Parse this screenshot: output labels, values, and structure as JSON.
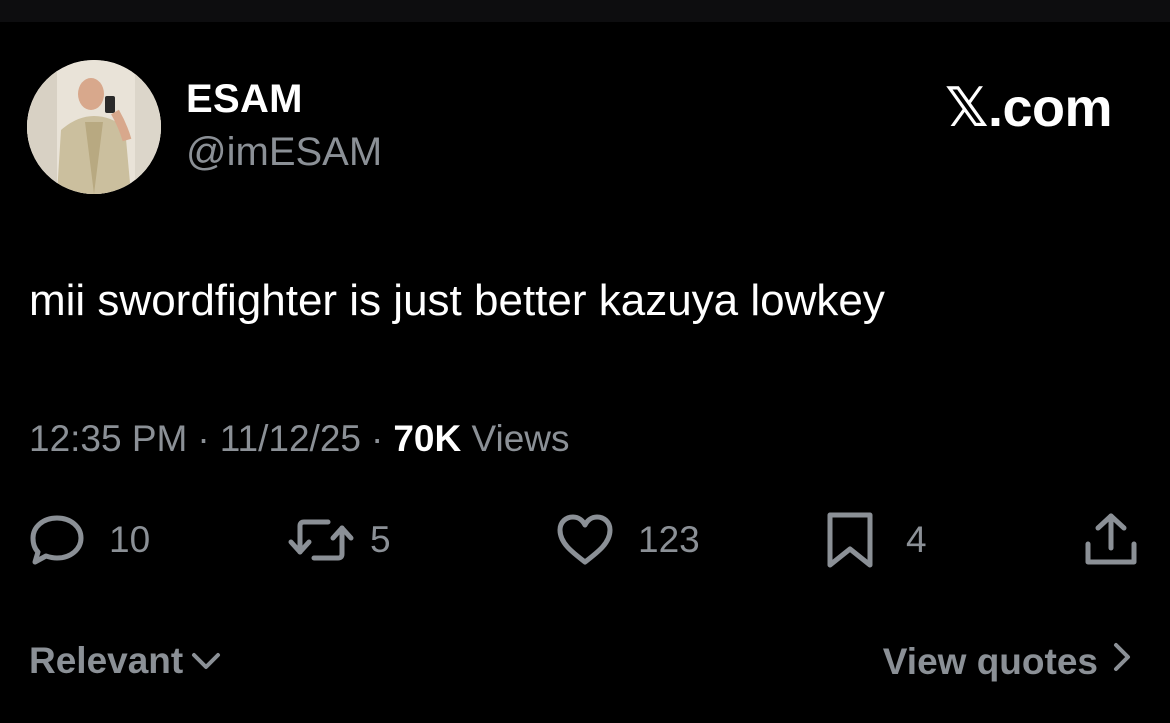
{
  "author": {
    "display_name": "ESAM",
    "handle": "@imESAM"
  },
  "brand": "𝕏.com",
  "tweet": {
    "text": "mii swordfighter is just better kazuya lowkey"
  },
  "meta": {
    "time": "12:35 PM",
    "separator": "·",
    "date": "11/12/25",
    "views_count": "70K",
    "views_label": "Views"
  },
  "actions": {
    "replies": "10",
    "reposts": "5",
    "likes": "123",
    "bookmarks": "4"
  },
  "footer": {
    "relevant_label": "Relevant",
    "view_quotes_label": "View quotes"
  },
  "colors": {
    "background": "#000000",
    "primary_text": "#ffffff",
    "secondary_text": "#8b9096"
  },
  "icons": [
    "reply-icon",
    "repost-icon",
    "like-icon",
    "bookmark-icon",
    "share-icon",
    "chevron-down-icon",
    "chevron-right-icon"
  ]
}
